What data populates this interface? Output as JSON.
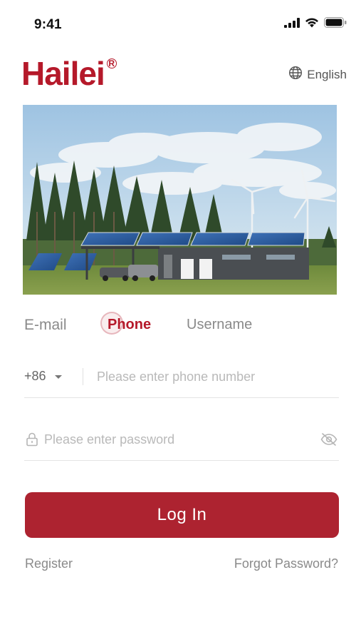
{
  "status_bar": {
    "time": "9:41",
    "icons": [
      "signal-icon",
      "wifi-icon",
      "battery-icon"
    ]
  },
  "header": {
    "logo_text": "Hailei",
    "logo_mark": "®",
    "language": "English",
    "language_icon": "globe-icon"
  },
  "hero": {
    "image": "solar-house-wind-turbines-photo"
  },
  "tabs": {
    "email": "E-mail",
    "phone": "Phone",
    "username": "Username",
    "active": "Phone"
  },
  "phone_field": {
    "country_code": "+86",
    "placeholder": "Please enter phone number",
    "value": ""
  },
  "password_field": {
    "placeholder": "Please enter password",
    "value": "",
    "lock_icon": "lock-icon",
    "visibility_icon": "eye-off-icon"
  },
  "login_button": {
    "label": "Log In"
  },
  "links": {
    "register": "Register",
    "forgot": "Forgot Password?"
  },
  "colors": {
    "brand": "#b5192a",
    "button": "#ad2330",
    "muted_text": "#8a8a8a",
    "placeholder": "#b9b9b9"
  }
}
